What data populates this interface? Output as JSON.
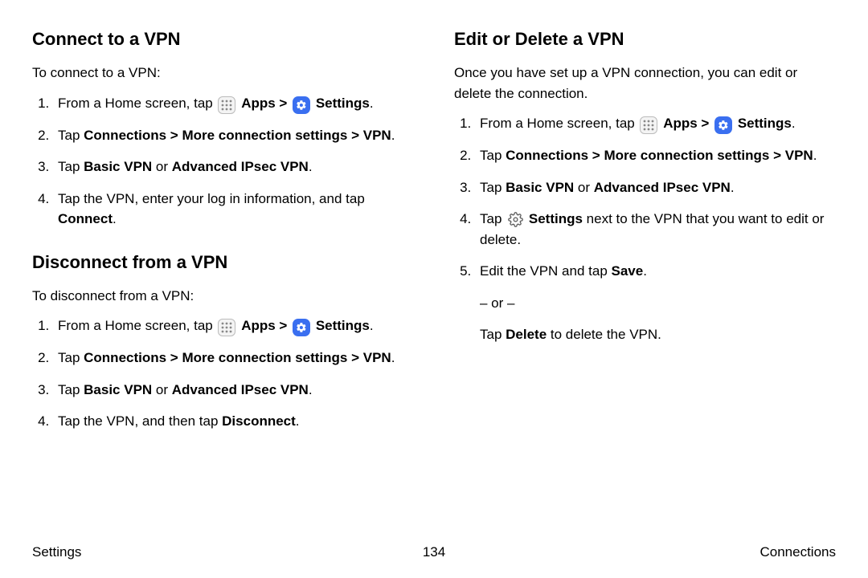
{
  "left": {
    "section1": {
      "title": "Connect to a VPN",
      "intro": "To connect to a VPN:",
      "step1_pre": "From a Home screen, tap ",
      "step1_apps": "Apps",
      "step1_gt": " > ",
      "step1_settings": "Settings",
      "step1_end": ".",
      "step2_t1": "Tap ",
      "step2_b1": "Connections > More connection settings > VPN",
      "step2_t2": ".",
      "step3_t1": "Tap ",
      "step3_b1": "Basic VPN",
      "step3_t2": " or ",
      "step3_b2": "Advanced IPsec VPN",
      "step3_t3": ".",
      "step4_t1": "Tap the VPN, enter your log in information, and tap ",
      "step4_b1": "Connect",
      "step4_t2": "."
    },
    "section2": {
      "title": "Disconnect from a VPN",
      "intro": "To disconnect from a VPN:",
      "step1_pre": "From a Home screen, tap ",
      "step1_apps": "Apps",
      "step1_gt": " > ",
      "step1_settings": "Settings",
      "step1_end": ".",
      "step2_t1": "Tap ",
      "step2_b1": "Connections > More connection settings > VPN",
      "step2_t2": ".",
      "step3_t1": "Tap ",
      "step3_b1": "Basic VPN",
      "step3_t2": " or ",
      "step3_b2": "Advanced IPsec VPN",
      "step3_t3": ".",
      "step4_t1": "Tap the VPN, and then tap ",
      "step4_b1": "Disconnect",
      "step4_t2": "."
    }
  },
  "right": {
    "section1": {
      "title": "Edit or Delete a VPN",
      "intro": "Once you have set up a VPN connection, you can edit or delete the connection.",
      "step1_pre": "From a Home screen, tap ",
      "step1_apps": "Apps",
      "step1_gt": " > ",
      "step1_settings": "Settings",
      "step1_end": ".",
      "step2_t1": "Tap ",
      "step2_b1": "Connections > More connection settings > VPN",
      "step2_t2": ".",
      "step3_t1": "Tap ",
      "step3_b1": "Basic VPN",
      "step3_t2": " or ",
      "step3_b2": "Advanced IPsec VPN",
      "step3_t3": ".",
      "step4_t1": "Tap ",
      "step4_b1": "Settings",
      "step4_t2": " next to the VPN that you want to edit or delete.",
      "step5_t1": "Edit the VPN and tap ",
      "step5_b1": "Save",
      "step5_t2": ".",
      "or": "– or –",
      "alt_t1": "Tap ",
      "alt_b1": "Delete",
      "alt_t2": " to delete the VPN."
    }
  },
  "footer": {
    "left": "Settings",
    "page": "134",
    "right": "Connections"
  }
}
